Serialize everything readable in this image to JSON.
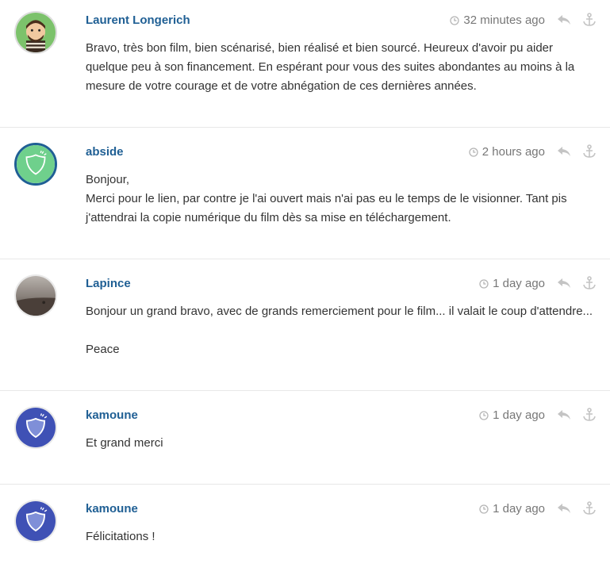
{
  "colors": {
    "author": "#1f5f94",
    "meta": "#777777",
    "text": "#333333",
    "divider": "#e8e8e8",
    "icon": "#b5b5b5"
  },
  "comments": [
    {
      "author": "Laurent Longerich",
      "time": "32 minutes ago",
      "avatar_icon": "cartoon-character-avatar",
      "lines": [
        "Bravo, très bon film, bien scénarisé, bien réalisé et bien sourcé. Heureux d'avoir pu aider quelque peu à son financement. En espérant pour vous des suites abondantes au moins à la mesure de votre courage et de votre abnégation de ces dernières années."
      ]
    },
    {
      "author": "abside",
      "time": "2 hours ago",
      "avatar_icon": "shield-avatar-green",
      "lines": [
        "Bonjour,",
        "Merci pour le lien, par contre je l'ai ouvert mais n'ai pas eu le temps de le visionner. Tant pis j'attendrai la copie numérique du film dès sa mise en téléchargement."
      ]
    },
    {
      "author": "Lapince",
      "time": "1 day ago",
      "avatar_icon": "photo-avatar",
      "lines": [
        "Bonjour un grand bravo, avec de grands remerciement pour le film... il valait le coup d'attendre...",
        "",
        "Peace"
      ]
    },
    {
      "author": "kamoune",
      "time": "1 day ago",
      "avatar_icon": "shield-avatar-blue",
      "lines": [
        "Et grand merci"
      ]
    },
    {
      "author": "kamoune",
      "time": "1 day ago",
      "avatar_icon": "shield-avatar-blue",
      "lines": [
        "Félicitations !"
      ]
    }
  ]
}
